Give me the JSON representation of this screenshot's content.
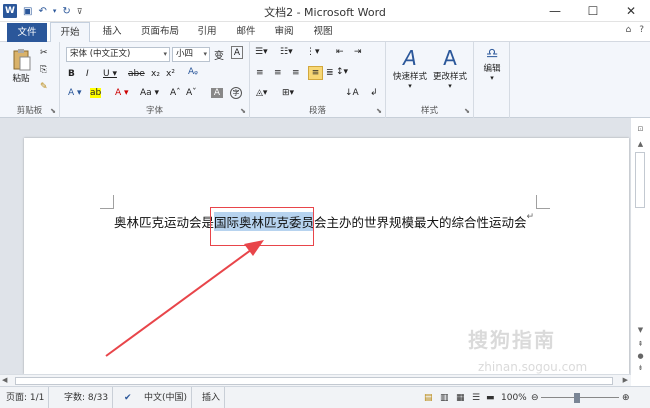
{
  "titlebar": {
    "title": "文档2 - Microsoft Word",
    "logo": "W",
    "minimize": "—",
    "maximize": "☐",
    "close": "✕"
  },
  "tabs": {
    "file": "文件",
    "home": "开始",
    "insert": "插入",
    "layout": "页面布局",
    "references": "引用",
    "mailings": "邮件",
    "review": "审阅",
    "view": "视图"
  },
  "ribbon": {
    "clipboard": {
      "label": "剪贴板",
      "paste": "粘贴"
    },
    "font": {
      "label": "字体",
      "face": "宋体 (中文正文)",
      "size": "小四"
    },
    "paragraph": {
      "label": "段落"
    },
    "styles": {
      "label": "样式",
      "quick": "快速样式",
      "change": "更改样式"
    },
    "editing": {
      "label": "编辑"
    }
  },
  "document": {
    "before": "奥林匹克运动会是",
    "selected": "国际奥林匹克委员",
    "after": "会主办的世界规模最大的综合性运动会",
    "mark": "↵"
  },
  "status": {
    "page": "页面: 1/1",
    "words": "字数: 8/33",
    "lang": "中文(中国)",
    "mode": "插入",
    "zoom": "100%"
  },
  "watermark": {
    "brand": "搜狗指南",
    "url": "zhinan.sogou.com"
  },
  "colors": {
    "accent": "#2b579a",
    "highlight": "#b7d3ef",
    "annotation": "#e8454a"
  }
}
